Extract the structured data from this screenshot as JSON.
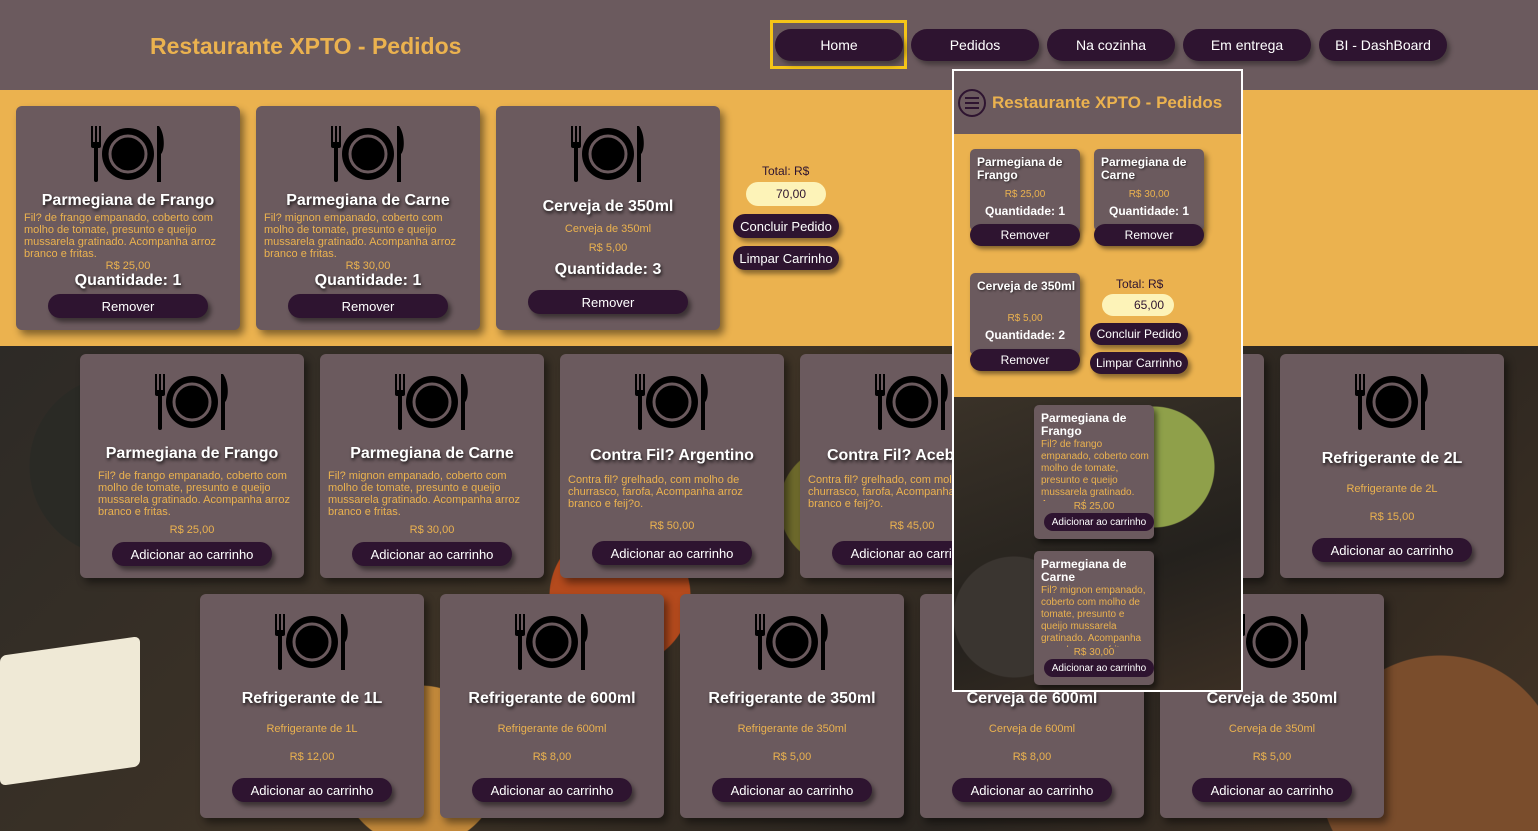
{
  "header": {
    "brand": "Restaurante XPTO - Pedidos",
    "nav": [
      "Home",
      "Pedidos",
      "Na cozinha",
      "Em entrega",
      "BI - DashBoard"
    ]
  },
  "cart": {
    "items": [
      {
        "name": "Parmegiana de Frango",
        "desc": "Fil? de frango empanado, coberto com molho de tomate, presunto e queijo mussarela gratinado. Acompanha arroz branco e fritas.",
        "price": "R$ 25,00",
        "qty": "Quantidade: 1",
        "btn": "Remover"
      },
      {
        "name": "Parmegiana de Carne",
        "desc": "Fil? mignon empanado, coberto com molho de tomate, presunto e queijo mussarela gratinado. Acompanha arroz branco e fritas.",
        "price": "R$ 30,00",
        "qty": "Quantidade: 1",
        "btn": "Remover"
      },
      {
        "name": "Cerveja de 350ml",
        "desc": "Cerveja de 350ml",
        "price": "R$ 5,00",
        "qty": "Quantidade: 3",
        "btn": "Remover"
      }
    ],
    "total_label": "Total: R$",
    "total_value": "70,00",
    "conclude": "Concluir Pedido",
    "clear": "Limpar Carrinho"
  },
  "menu": {
    "add_label": "Adicionar ao carrinho",
    "row1": [
      {
        "name": "Parmegiana de Frango",
        "desc": "Fil? de frango empanado, coberto com molho de tomate, presunto e queijo mussarela gratinado. Acompanha arroz branco e fritas.",
        "price": "R$ 25,00"
      },
      {
        "name": "Parmegiana de Carne",
        "desc": "Fil? mignon empanado, coberto com molho de tomate, presunto e queijo mussarela gratinado. Acompanha arroz branco e fritas.",
        "price": "R$ 30,00"
      },
      {
        "name": "Contra Fil? Argentino",
        "desc": "Contra fil? grelhado, com molho de churrasco, farofa, Acompanha arroz branco e feij?o.",
        "price": "R$ 50,00"
      },
      {
        "name": "Contra Fil? Acebolado",
        "desc": "Contra fil? grelhado, com molho de churrasco, farofa, Acompanha arroz branco e feij?o.",
        "price": "R$ 45,00"
      },
      {
        "name": "Refrigerante de 2L",
        "desc": "Refrigerante de 2L",
        "price": "R$ 15,00"
      }
    ],
    "row2": [
      {
        "name": "Refrigerante de 1L",
        "desc": "Refrigerante de 1L",
        "price": "R$ 12,00"
      },
      {
        "name": "Refrigerante de 600ml",
        "desc": "Refrigerante de 600ml",
        "price": "R$ 8,00"
      },
      {
        "name": "Refrigerante de 350ml",
        "desc": "Refrigerante de 350ml",
        "price": "R$ 5,00"
      },
      {
        "name": "Cerveja de 600ml",
        "desc": "Cerveja de 600ml",
        "price": "R$ 8,00"
      },
      {
        "name": "Cerveja de 350ml",
        "desc": "Cerveja de 350ml",
        "price": "R$ 5,00"
      }
    ]
  },
  "mobile": {
    "brand": "Restaurante XPTO - Pedidos",
    "cart_items": [
      {
        "name": "Parmegiana de Frango",
        "price": "R$ 25,00",
        "qty": "Quantidade: 1",
        "btn": "Remover"
      },
      {
        "name": "Parmegiana de Carne",
        "price": "R$ 30,00",
        "qty": "Quantidade: 1",
        "btn": "Remover"
      },
      {
        "name": "Cerveja de 350ml",
        "price": "R$ 5,00",
        "qty": "Quantidade: 2",
        "btn": "Remover"
      }
    ],
    "total_label": "Total: R$",
    "total_value": "65,00",
    "conclude": "Concluir Pedido",
    "clear": "Limpar Carrinho",
    "products": [
      {
        "name": "Parmegiana de Frango",
        "desc": "Fil? de frango empanado, coberto com molho de tomate, presunto e queijo mussarela gratinado. Acompanha arroz branco e fritas.",
        "price": "R$ 25,00"
      },
      {
        "name": "Parmegiana de Carne",
        "desc": "Fil? mignon empanado, coberto com molho de tomate, presunto e queijo mussarela gratinado. Acompanha arroz branco e fritas.",
        "price": "R$ 30,00"
      }
    ],
    "add_label": "Adicionar ao carrinho"
  },
  "colors": {
    "header_bg": "#6b5a5e",
    "accent": "#ebb24f",
    "button": "#2e1430",
    "focus": "#f5c518"
  }
}
